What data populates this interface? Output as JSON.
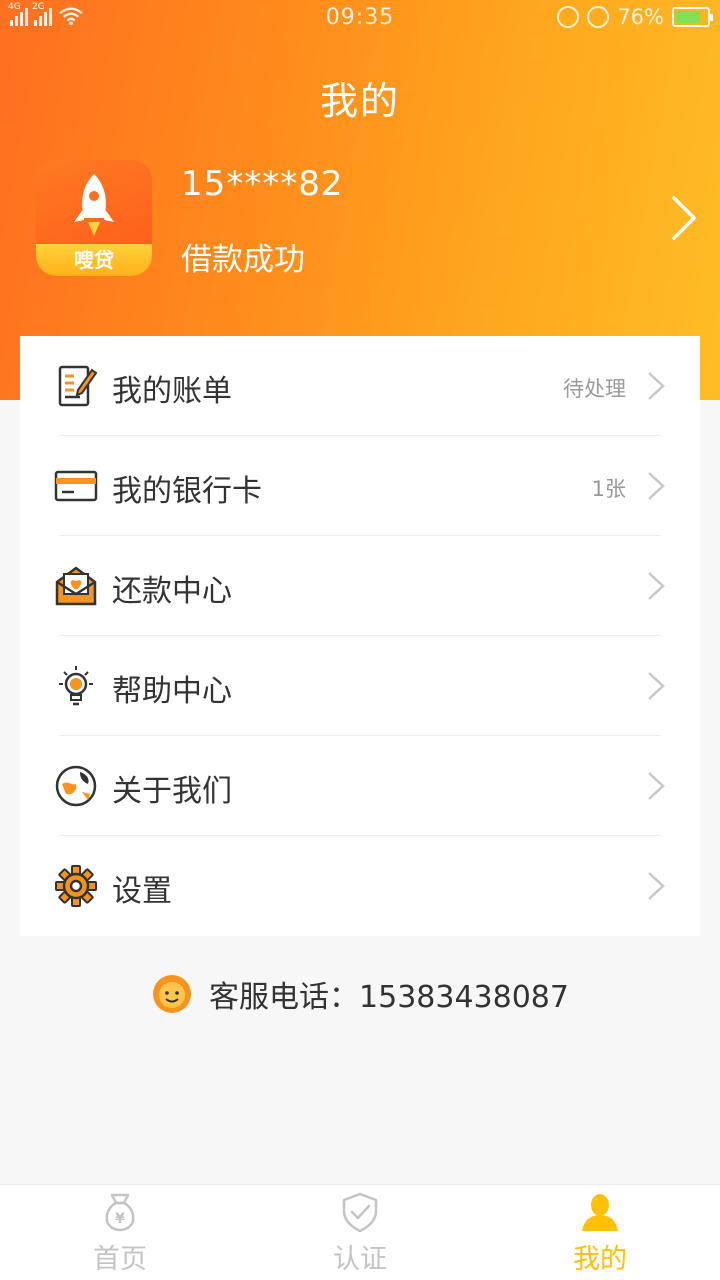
{
  "status_bar": {
    "network1": "4G",
    "network2": "2G",
    "time": "09:35",
    "battery": "76%"
  },
  "header": {
    "title": "我的",
    "logo_text": "嗖贷",
    "phone": "15****82",
    "loan_status": "借款成功"
  },
  "menu": {
    "items": [
      {
        "label": "我的账单",
        "badge": "待处理",
        "icon": "bill-icon"
      },
      {
        "label": "我的银行卡",
        "badge": "1张",
        "icon": "bank-card-icon"
      },
      {
        "label": "还款中心",
        "badge": "",
        "icon": "envelope-heart-icon"
      },
      {
        "label": "帮助中心",
        "badge": "",
        "icon": "lightbulb-icon"
      },
      {
        "label": "关于我们",
        "badge": "",
        "icon": "globe-icon"
      },
      {
        "label": "设置",
        "badge": "",
        "icon": "gear-icon"
      }
    ]
  },
  "service": {
    "text": "客服电话：15383438087"
  },
  "tabbar": {
    "tabs": [
      {
        "label": "首页",
        "icon": "money-bag-icon",
        "active": false
      },
      {
        "label": "认证",
        "icon": "shield-check-icon",
        "active": false
      },
      {
        "label": "我的",
        "icon": "user-icon",
        "active": true
      }
    ]
  },
  "colors": {
    "header_start": "#ff6f20",
    "header_end": "#ffbd25",
    "icon_orange": "#f7931e",
    "active_tab": "#ffc107"
  }
}
